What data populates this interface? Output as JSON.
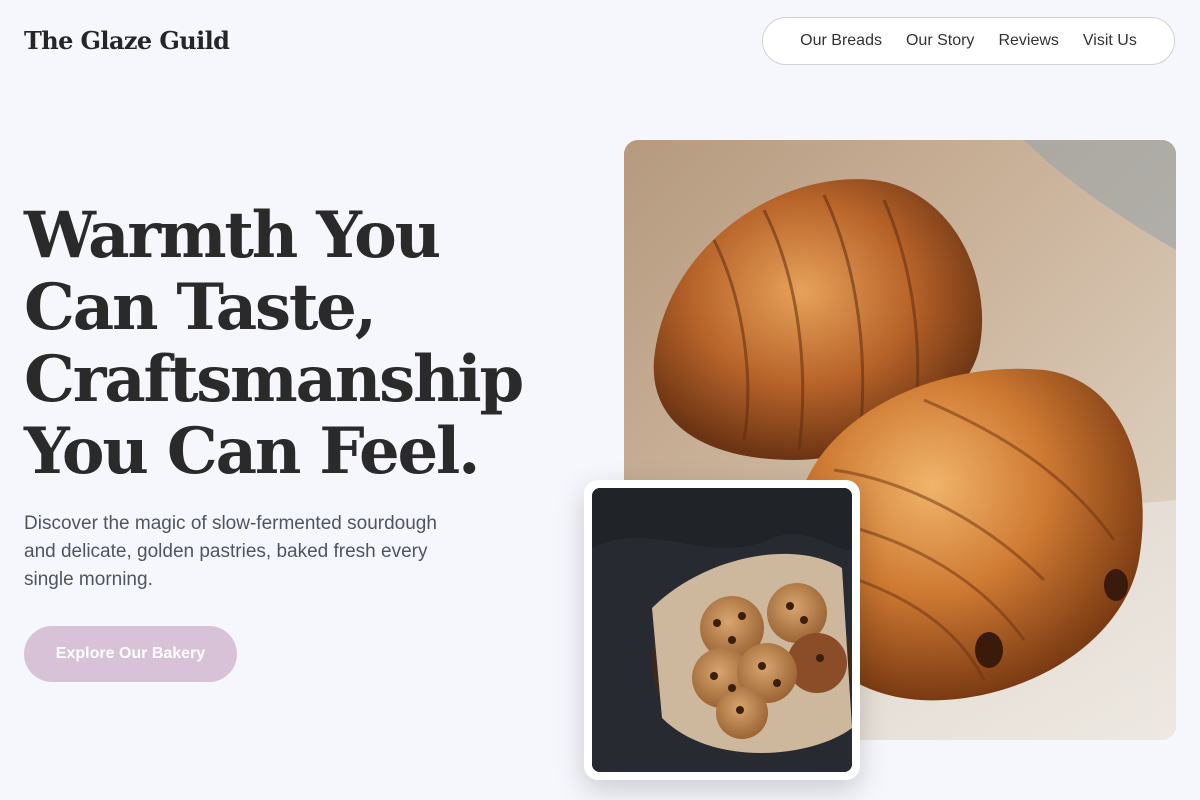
{
  "brand": {
    "name": "The Glaze Guild"
  },
  "nav": {
    "items": [
      {
        "label": "Our Breads"
      },
      {
        "label": "Our Story"
      },
      {
        "label": "Reviews"
      },
      {
        "label": "Visit Us"
      }
    ]
  },
  "hero": {
    "headline": "Warmth You Can Taste, Craftsmanship You Can Feel.",
    "subtext": "Discover the magic of slow-fermented sourdough and delicate, golden pastries, baked fresh every single morning.",
    "cta_label": "Explore Our Bakery"
  },
  "images": {
    "main_subject": "croissants",
    "card_subject": "chocolate-chip-cookies"
  },
  "colors": {
    "background": "#f6f7fc",
    "cta": "#d8c2d8",
    "text": "#2a2a2a"
  }
}
